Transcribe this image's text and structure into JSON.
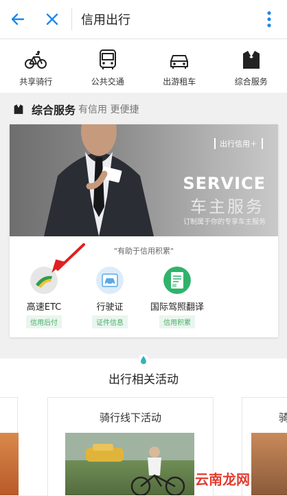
{
  "header": {
    "title": "信用出行"
  },
  "categories": [
    {
      "label": "共享骑行",
      "icon": "bicycle-icon"
    },
    {
      "label": "公共交通",
      "icon": "bus-icon"
    },
    {
      "label": "出游租车",
      "icon": "car-icon"
    },
    {
      "label": "综合服务",
      "icon": "suit-icon"
    }
  ],
  "section": {
    "title": "综合服务",
    "subtitle": "有信用 更便捷"
  },
  "banner": {
    "tag": "出行信用＋",
    "heading": "SERVICE",
    "heading_cn": "车主服务",
    "tagline": "订制属于你的专享车主服务"
  },
  "motto": "\"有助于信用积累\"",
  "services": [
    {
      "name": "高速ETC",
      "badge": "信用后付",
      "icon": "etc-highway-icon"
    },
    {
      "name": "行驶证",
      "badge": "证件信息",
      "icon": "license-car-icon"
    },
    {
      "name": "国际驾照翻译",
      "badge": "信用积累",
      "icon": "document-icon"
    }
  ],
  "activity": {
    "title": "出行相关活动",
    "cards": [
      {
        "title": "骑行线下活动"
      },
      {
        "title": "骑"
      }
    ]
  },
  "watermark": "云南龙网",
  "colors": {
    "accent": "#1e88e5",
    "badge_green": "#4cae6b",
    "arrow_red": "#e02020"
  }
}
